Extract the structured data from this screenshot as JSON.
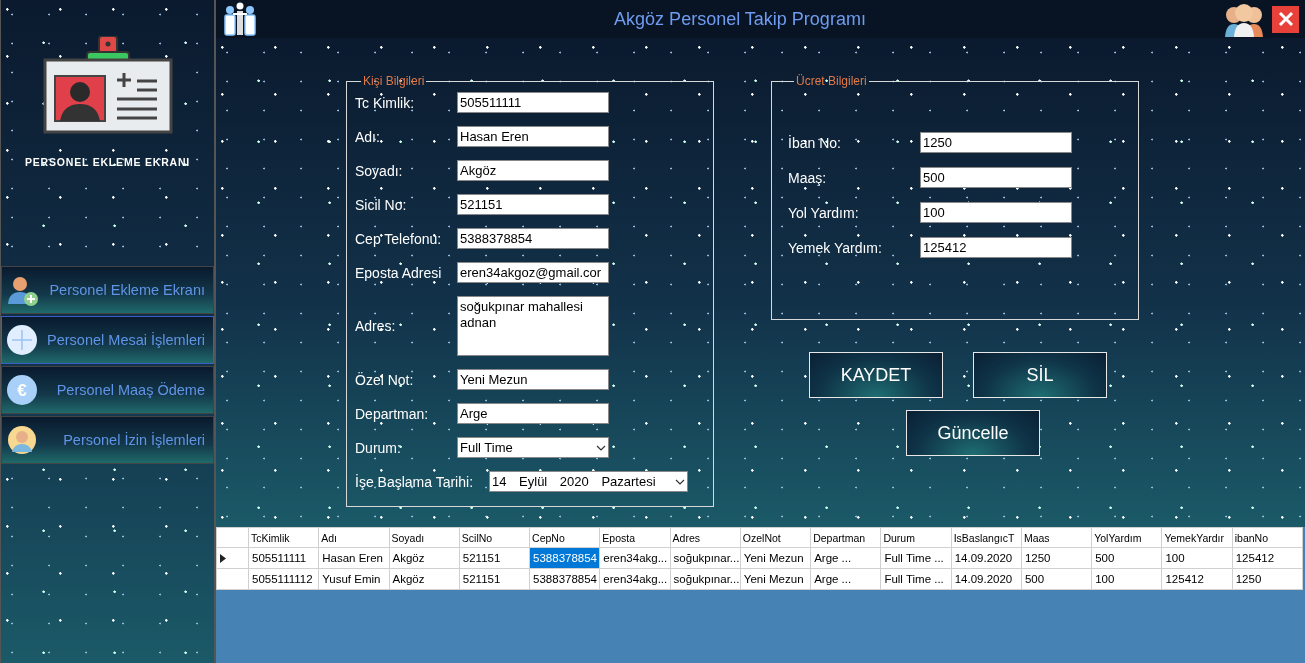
{
  "window": {
    "title": "Akgöz Personel Takip Programı"
  },
  "sidebar": {
    "heading": "PERSONEL EKLEME EKRANI",
    "items": [
      {
        "label": "Personel Ekleme Ekranı",
        "kind": "person-add",
        "selected": false
      },
      {
        "label": "Personel Mesai İşlemleri",
        "kind": "plus",
        "selected": true
      },
      {
        "label": "Personel Maaş Ödeme",
        "kind": "euro",
        "glyph": "€",
        "selected": false
      },
      {
        "label": "Personel İzin İşlemleri",
        "kind": "avatar",
        "selected": false
      }
    ]
  },
  "personal_group": {
    "title": "Kişi Bilgileri",
    "fields": [
      {
        "label": "Tc Kimlik:",
        "kind": "text",
        "value": "505511111"
      },
      {
        "label": "Adı:",
        "kind": "text",
        "value": "Hasan Eren"
      },
      {
        "label": "Soyadı:",
        "kind": "text",
        "value": "Akgöz"
      },
      {
        "label": "Sicil No:",
        "kind": "text",
        "value": "521151"
      },
      {
        "label": "Cep Telefonu:",
        "kind": "text",
        "value": "5388378854"
      },
      {
        "label": "Eposta Adresi",
        "kind": "text",
        "value": "eren34akgoz@gmail.cor"
      },
      {
        "label": "Adres:",
        "kind": "textarea",
        "value": "soğukpınar mahallesi adnan"
      },
      {
        "label": "Özel Not:",
        "kind": "text",
        "value": "Yeni Mezun"
      },
      {
        "label": "Departman:",
        "kind": "text",
        "value": "Arge"
      },
      {
        "label": "Durum:",
        "kind": "select",
        "value": "Full Time"
      },
      {
        "label": "İşe Başlama Tarihi:",
        "kind": "date",
        "value": "14 Eylül 2020 Pazartesi"
      }
    ]
  },
  "wage_group": {
    "title": "Ücret Bilgileri",
    "fields": [
      {
        "label": "İban No:",
        "kind": "text",
        "value": "1250"
      },
      {
        "label": "Maaş:",
        "kind": "text",
        "value": "500"
      },
      {
        "label": "Yol Yardım:",
        "kind": "text",
        "value": "100"
      },
      {
        "label": "Yemek Yardım:",
        "kind": "text",
        "value": "125412"
      }
    ]
  },
  "buttons": [
    "KAYDET",
    "SİL",
    "Güncelle"
  ],
  "table": {
    "columns": [
      "TcKimlik",
      "Adı",
      "Soyadı",
      "ScilNo",
      "CepNo",
      "Eposta",
      "Adres",
      "OzelNot",
      "Departman",
      "Durum",
      "IsBaslangıcT",
      "Maas",
      "YolYardım",
      "YemekYardır",
      "ibanNo"
    ],
    "rows": [
      {
        "current": true,
        "cells": [
          {
            "text": "505511111",
            "selected": false
          },
          {
            "text": "Hasan Eren",
            "selected": false
          },
          {
            "text": "Akgöz",
            "selected": false
          },
          {
            "text": "521151",
            "selected": false
          },
          {
            "text": "5388378854",
            "selected": true
          },
          {
            "text": "eren34akg...",
            "selected": false
          },
          {
            "text": "soğukpınar...",
            "selected": false
          },
          {
            "text": "Yeni Mezun",
            "selected": false
          },
          {
            "text": "Arge ...",
            "selected": false
          },
          {
            "text": "Full Time ...",
            "selected": false
          },
          {
            "text": "14.09.2020",
            "selected": false
          },
          {
            "text": "1250",
            "selected": false
          },
          {
            "text": "500",
            "selected": false
          },
          {
            "text": "100",
            "selected": false
          },
          {
            "text": "125412",
            "selected": false
          }
        ]
      },
      {
        "current": false,
        "cells": [
          {
            "text": "5055111112",
            "selected": false
          },
          {
            "text": "Yusuf Emin",
            "selected": false
          },
          {
            "text": "Akgöz",
            "selected": false
          },
          {
            "text": "521151",
            "selected": false
          },
          {
            "text": "5388378854",
            "selected": false
          },
          {
            "text": "eren34akg...",
            "selected": false
          },
          {
            "text": "soğukpınar...",
            "selected": false
          },
          {
            "text": "Yeni Mezun",
            "selected": false
          },
          {
            "text": "Arge ...",
            "selected": false
          },
          {
            "text": "Full Time ...",
            "selected": false
          },
          {
            "text": "14.09.2020",
            "selected": false
          },
          {
            "text": "500",
            "selected": false
          },
          {
            "text": "100",
            "selected": false
          },
          {
            "text": "125412",
            "selected": false
          },
          {
            "text": "1250",
            "selected": false
          }
        ]
      }
    ]
  }
}
